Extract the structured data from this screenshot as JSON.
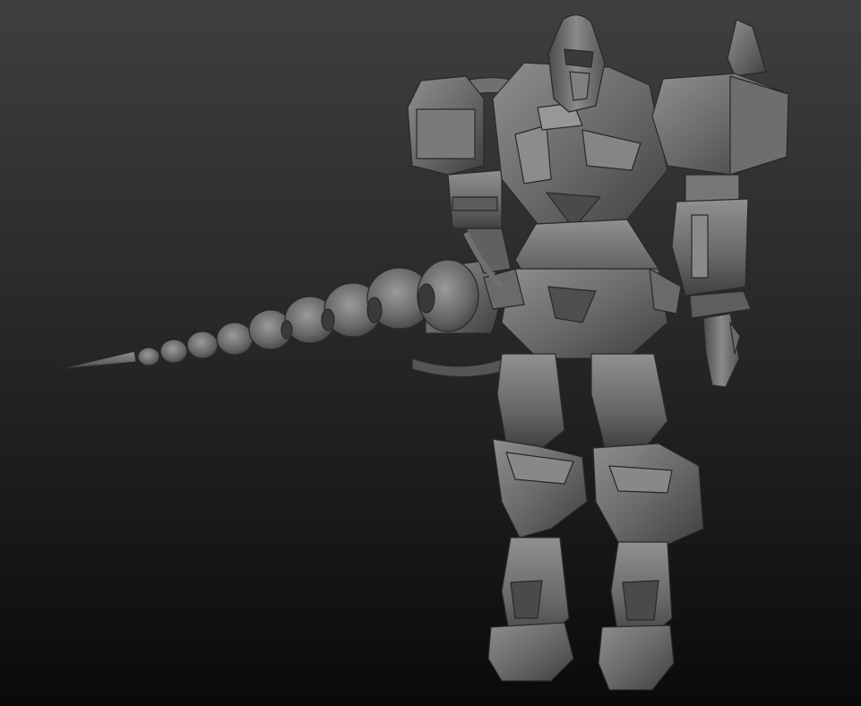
{
  "viewport": {
    "description_icon": "sculpt-viewport",
    "background_top": "#3e3e3e",
    "background_bottom": "#0b0b0b",
    "model_base_color": "#6a6a6a",
    "model_highlight_color": "#9a9a9a",
    "model_shadow_color": "#2e2e2e"
  }
}
